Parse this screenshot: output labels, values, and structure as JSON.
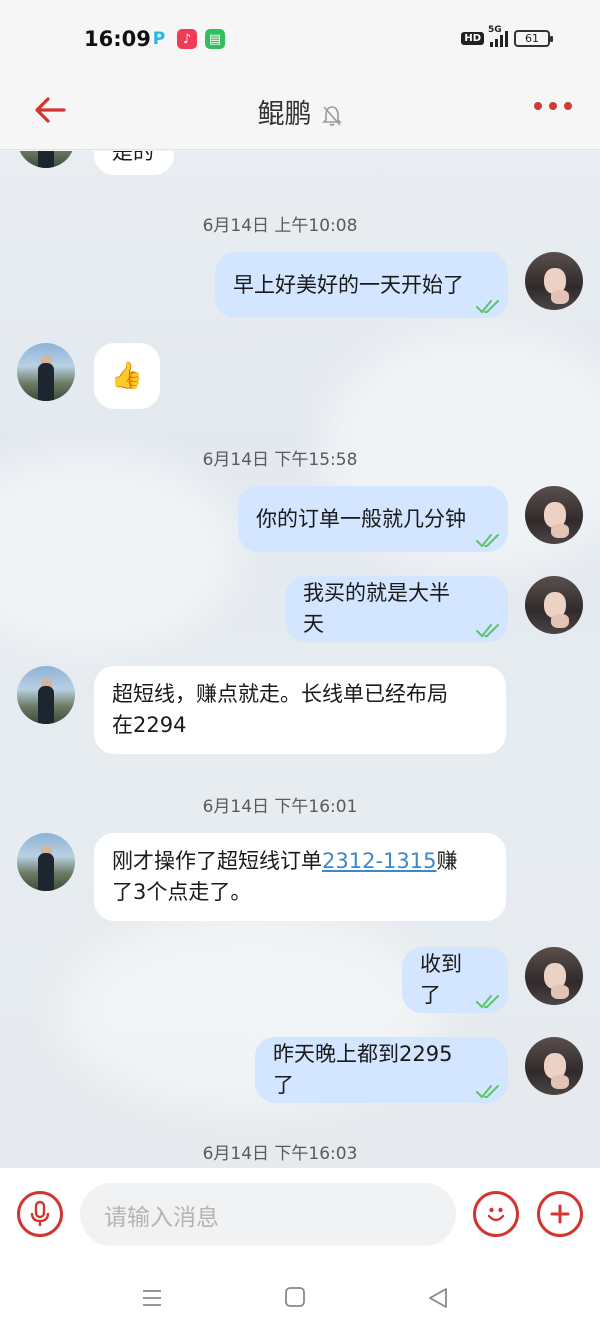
{
  "status_bar": {
    "time": "16:09",
    "network": "5G",
    "hd": "HD",
    "battery": "61"
  },
  "header": {
    "title": "鲲鹏"
  },
  "messages": [
    {
      "id": 0,
      "side": "left",
      "text": "是的"
    },
    {
      "id": 1,
      "type": "timestamp",
      "text": "6月14日 上午10:08"
    },
    {
      "id": 2,
      "side": "right",
      "text": "早上好美好的一天开始了"
    },
    {
      "id": 3,
      "side": "left",
      "text": "👍"
    },
    {
      "id": 4,
      "type": "timestamp",
      "text": "6月14日 下午15:58"
    },
    {
      "id": 5,
      "side": "right",
      "text": "你的订单一般就几分钟"
    },
    {
      "id": 6,
      "side": "right",
      "text": "我买的就是大半天"
    },
    {
      "id": 7,
      "side": "left",
      "line1": "超短线，赚点就走。长线单已经布局",
      "line2": "在2294"
    },
    {
      "id": 8,
      "type": "timestamp",
      "text": "6月14日 下午16:01"
    },
    {
      "id": 9,
      "side": "left",
      "pre": "刚才操作了超短线订单",
      "link": "2312-1315",
      "post": "赚",
      "line2": "了3个点走了。"
    },
    {
      "id": 10,
      "side": "right",
      "text": "收到了"
    },
    {
      "id": 11,
      "side": "right",
      "text": "昨天晚上都到2295了"
    },
    {
      "id": 12,
      "type": "timestamp",
      "text": "6月14日 下午16:03"
    }
  ],
  "input": {
    "placeholder": "请输入消息"
  },
  "colors": {
    "accent": "#d2342f",
    "sent_bubble": "#d3e5ff",
    "received_bubble": "#ffffff"
  }
}
